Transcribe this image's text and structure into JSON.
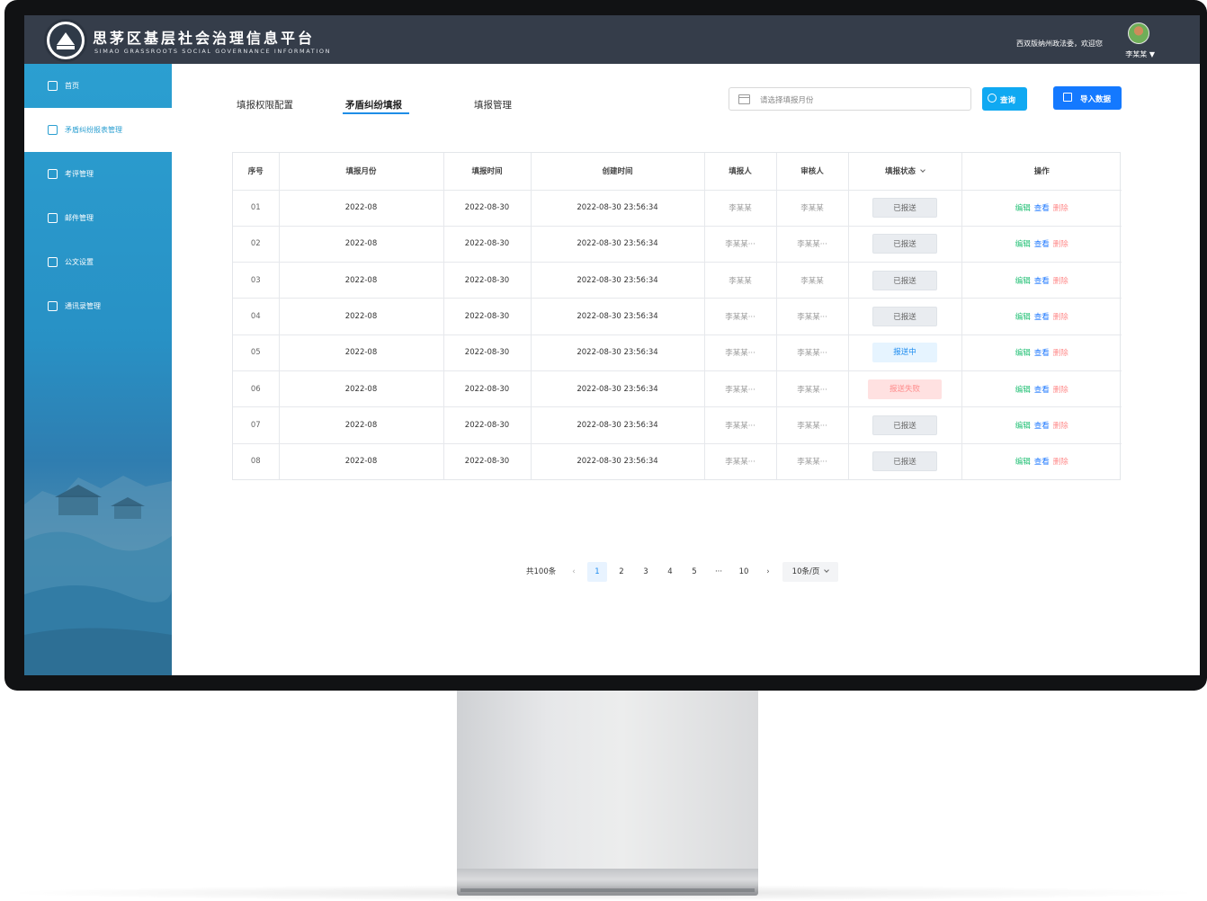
{
  "header": {
    "title": "思茅区基层社会治理信息平台",
    "subtitle": "SIMAO GRASSROOTS SOCIAL GOVERNANCE INFORMATION",
    "welcome": "西双版纳州政法委，欢迎您",
    "username": "李某某 ▼"
  },
  "sidebar": {
    "items": [
      {
        "label": "首页",
        "icon": "home-icon"
      },
      {
        "label": "矛盾纠纷报表管理",
        "icon": "report-icon",
        "active": true
      },
      {
        "label": "考评管理",
        "icon": "evaluation-icon"
      },
      {
        "label": "邮件管理",
        "icon": "mail-icon"
      },
      {
        "label": "公文设置",
        "icon": "document-icon"
      },
      {
        "label": "通讯录管理",
        "icon": "contacts-icon"
      }
    ]
  },
  "tabs": [
    {
      "label": "填报权限配置"
    },
    {
      "label": "矛盾纠纷填报",
      "active": true
    },
    {
      "label": "填报管理"
    }
  ],
  "search": {
    "placeholder": "请选择填报月份"
  },
  "buttons": {
    "query": "查询",
    "import": "导入数据"
  },
  "table": {
    "columns": [
      "序号",
      "填报月份",
      "填报时间",
      "创建时间",
      "填报人",
      "审核人",
      "填报状态",
      "操作"
    ],
    "rows": [
      {
        "seq": "01",
        "month": "2022-08",
        "report_time": "2022-08-30",
        "created": "2022-08-30 23:56:34",
        "reporter": "李某某",
        "reviewer": "李某某",
        "status": "已报送",
        "status_type": "done"
      },
      {
        "seq": "02",
        "month": "2022-08",
        "report_time": "2022-08-30",
        "created": "2022-08-30 23:56:34",
        "reporter": "李某某···",
        "reviewer": "李某某···",
        "status": "已报送",
        "status_type": "done"
      },
      {
        "seq": "03",
        "month": "2022-08",
        "report_time": "2022-08-30",
        "created": "2022-08-30 23:56:34",
        "reporter": "李某某",
        "reviewer": "李某某",
        "status": "已报送",
        "status_type": "done"
      },
      {
        "seq": "04",
        "month": "2022-08",
        "report_time": "2022-08-30",
        "created": "2022-08-30 23:56:34",
        "reporter": "李某某···",
        "reviewer": "李某某···",
        "status": "已报送",
        "status_type": "done"
      },
      {
        "seq": "05",
        "month": "2022-08",
        "report_time": "2022-08-30",
        "created": "2022-08-30 23:56:34",
        "reporter": "李某某···",
        "reviewer": "李某某···",
        "status": "报送中",
        "status_type": "sending"
      },
      {
        "seq": "06",
        "month": "2022-08",
        "report_time": "2022-08-30",
        "created": "2022-08-30 23:56:34",
        "reporter": "李某某···",
        "reviewer": "李某某···",
        "status": "报送失败",
        "status_type": "failed"
      },
      {
        "seq": "07",
        "month": "2022-08",
        "report_time": "2022-08-30",
        "created": "2022-08-30 23:56:34",
        "reporter": "李某某···",
        "reviewer": "李某某···",
        "status": "已报送",
        "status_type": "done"
      },
      {
        "seq": "08",
        "month": "2022-08",
        "report_time": "2022-08-30",
        "created": "2022-08-30 23:56:34",
        "reporter": "李某某···",
        "reviewer": "李某某···",
        "status": "已报送",
        "status_type": "done"
      }
    ],
    "actions": {
      "edit": "编辑",
      "view": "查看",
      "delete": "删除"
    }
  },
  "pagination": {
    "total": "共100条",
    "pages": [
      "1",
      "2",
      "3",
      "4",
      "5",
      "···",
      "10"
    ],
    "current": "1",
    "page_size": "10条/页"
  },
  "colors": {
    "header_bg": "#353d4a",
    "sidebar_bg": "#2b9fd1",
    "primary": "#1479ff",
    "query_btn": "#10a9f2",
    "edit": "#1fbf73",
    "view": "#1f79ff",
    "delete": "#ff8c8c"
  }
}
